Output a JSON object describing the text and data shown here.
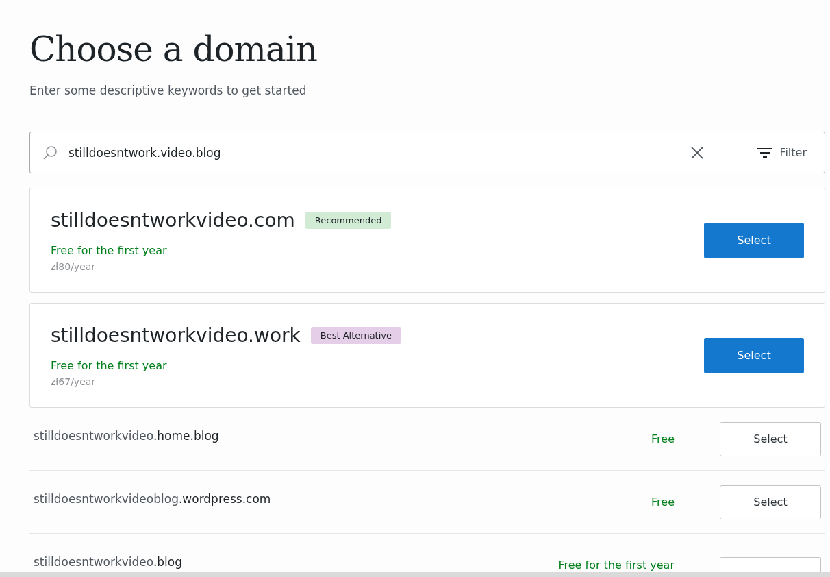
{
  "title": "Choose a domain",
  "subtitle": "Enter some descriptive keywords to get started",
  "search": {
    "value": "stilldoesntwork.video.blog",
    "filter_label": "Filter"
  },
  "featured": [
    {
      "domain": "stilldoesntworkvideo.com",
      "badge": {
        "label": "Recommended",
        "kind": "recommended"
      },
      "price": "Free for the first year",
      "old_price": "zł80/year",
      "button": "Select"
    },
    {
      "domain": "stilldoesntworkvideo.work",
      "badge": {
        "label": "Best Alternative",
        "kind": "alternative"
      },
      "price": "Free for the first year",
      "old_price": "zł67/year",
      "button": "Select"
    }
  ],
  "results": [
    {
      "name": "stilldoesntworkvideo",
      "suffix": ".home.blog",
      "price": "Free",
      "button": "Select"
    },
    {
      "name": "stilldoesntworkvideoblog",
      "suffix": ".wordpress.com",
      "price": "Free",
      "button": "Select"
    },
    {
      "name": "stilldoesntworkvideo",
      "suffix": ".blog",
      "price": "Free for the first year"
    }
  ]
}
